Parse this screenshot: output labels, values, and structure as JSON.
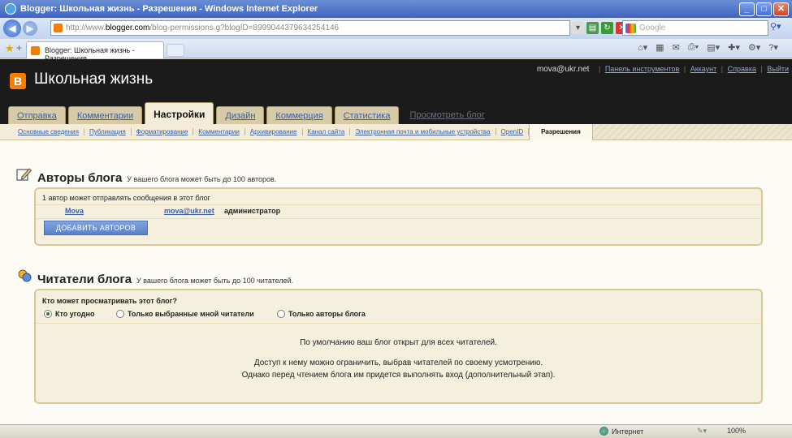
{
  "window": {
    "title": "Blogger: Школьная жизнь - Разрешения - Windows Internet Explorer"
  },
  "address": {
    "url_prefix": "http://www.",
    "url_domain": "blogger.com",
    "url_rest": "/blog-permissions.g?blogID=8999044379634254146",
    "search_placeholder": "Google"
  },
  "ie_tab": {
    "label": "Blogger: Школьная жизнь - Разрешения"
  },
  "blog": {
    "title": "Школьная жизнь",
    "logo_letter": "B",
    "user_email": "mova@ukr.net",
    "top_links": [
      "Панель инструментов",
      "Аккаунт",
      "Справка",
      "Выйти"
    ]
  },
  "main_tabs": [
    {
      "label": "Отправка",
      "active": false
    },
    {
      "label": "Комментарии",
      "active": false
    },
    {
      "label": "Настройки",
      "active": true
    },
    {
      "label": "Дизайн",
      "active": false
    },
    {
      "label": "Коммерция",
      "active": false
    },
    {
      "label": "Статистика",
      "active": false
    }
  ],
  "view_blog_label": "Просмотреть блог",
  "sub_tabs": [
    {
      "label": "Основные сведения",
      "active": false
    },
    {
      "label": "Публикация",
      "active": false
    },
    {
      "label": "Форматирование",
      "active": false
    },
    {
      "label": "Комментарии",
      "active": false
    },
    {
      "label": "Архивирование",
      "active": false
    },
    {
      "label": "Канал сайта",
      "active": false
    },
    {
      "label": "Электронная почта и мобильные устройства",
      "active": false
    },
    {
      "label": "OpenID",
      "active": false
    },
    {
      "label": "Разрешения",
      "active": true
    }
  ],
  "authors": {
    "heading": "Авторы блога",
    "subheading": "У вашего блога может быть до 100 авторов.",
    "count_text": "1 автор может отправлять сообщения в этот блог",
    "list": [
      {
        "name": "Mova",
        "email": "mova@ukr.net",
        "role": "администратор"
      }
    ],
    "add_button": "ДОБАВИТЬ АВТОРОВ"
  },
  "readers": {
    "heading": "Читатели блога",
    "subheading": "У вашего блога может быть до 100 читателей.",
    "question": "Кто может просматривать этот блог?",
    "options": [
      {
        "label": "Кто угодно",
        "selected": true
      },
      {
        "label": "Только выбранные мной читатели",
        "selected": false
      },
      {
        "label": "Только авторы блога",
        "selected": false
      }
    ],
    "message_1": "По умолчанию ваш блог открыт для всех читателей.",
    "message_2": "Доступ к нему можно ограничить, выбрав читателей по своему усмотрению.",
    "message_3": "Однако перед чтением блога им придется выполнять вход (дополнительный этап)."
  },
  "status": {
    "zone": "Интернет",
    "zoom": "100%"
  },
  "colors": {
    "blogger_orange": "#f57d00",
    "header_bg": "#1b1b1b",
    "link": "#3a5da6",
    "tab_bg": "#d6cba6",
    "box_border": "#d9c894"
  }
}
